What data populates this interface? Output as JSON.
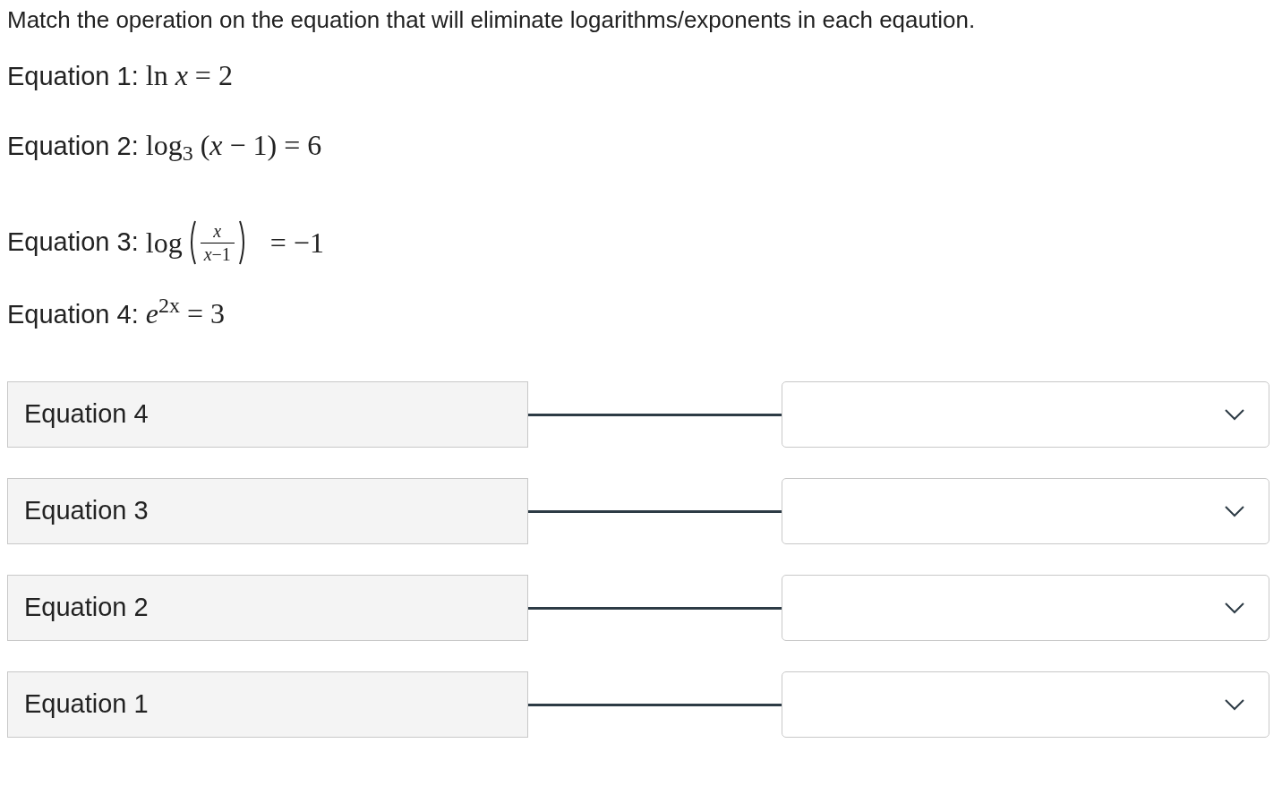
{
  "instruction": "Match the operation on the equation that will eliminate logarithms/exponents in each eqaution.",
  "equations": [
    {
      "kind": "plain",
      "label": "Equation 1:",
      "math": "ln *x* = 2"
    },
    {
      "kind": "plain",
      "label": "Equation 2:",
      "math": "log$_{3}$ (*x* − 1) = 6"
    },
    {
      "kind": "fraction",
      "label": "Equation 3:",
      "func": "log",
      "numerator": "*x*",
      "denominator": "*x*−1",
      "rhs": "= −1"
    },
    {
      "kind": "plain",
      "label": "Equation 4:",
      "math": "*e*$^{2x}$ = 3"
    }
  ],
  "matches": [
    {
      "prompt": "Equation 4"
    },
    {
      "prompt": "Equation 3"
    },
    {
      "prompt": "Equation 2"
    },
    {
      "prompt": "Equation 1"
    }
  ]
}
